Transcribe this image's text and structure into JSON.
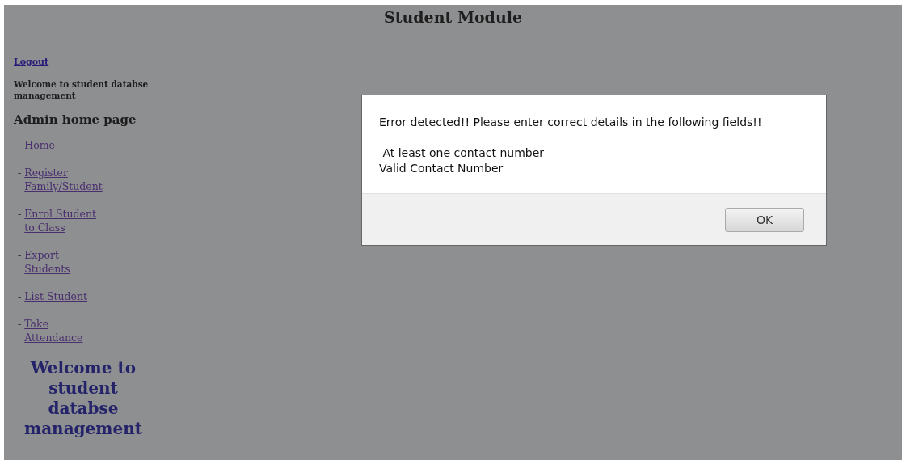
{
  "header": {
    "title": "Student Module"
  },
  "sidebar": {
    "logout": "Logout",
    "welcome": "Welcome to student databse management",
    "heading": "Admin home page",
    "links": [
      {
        "prefix": "-",
        "label": "Home"
      },
      {
        "prefix": "-",
        "label": "Register Family/Student"
      },
      {
        "prefix": "-",
        "label": "Enrol Student to Class"
      },
      {
        "prefix": "-",
        "label": "Export Students"
      },
      {
        "prefix": "-",
        "label": "List Student"
      },
      {
        "prefix": "-",
        "label": "Take Attendance"
      }
    ],
    "banner": "Welcome to student databse management"
  },
  "dialog": {
    "message": "Error detected!! Please enter correct details in the following fields!!",
    "fields": [
      " At least one contact number",
      "Valid Contact Number"
    ],
    "buttons": [
      "OK"
    ]
  }
}
